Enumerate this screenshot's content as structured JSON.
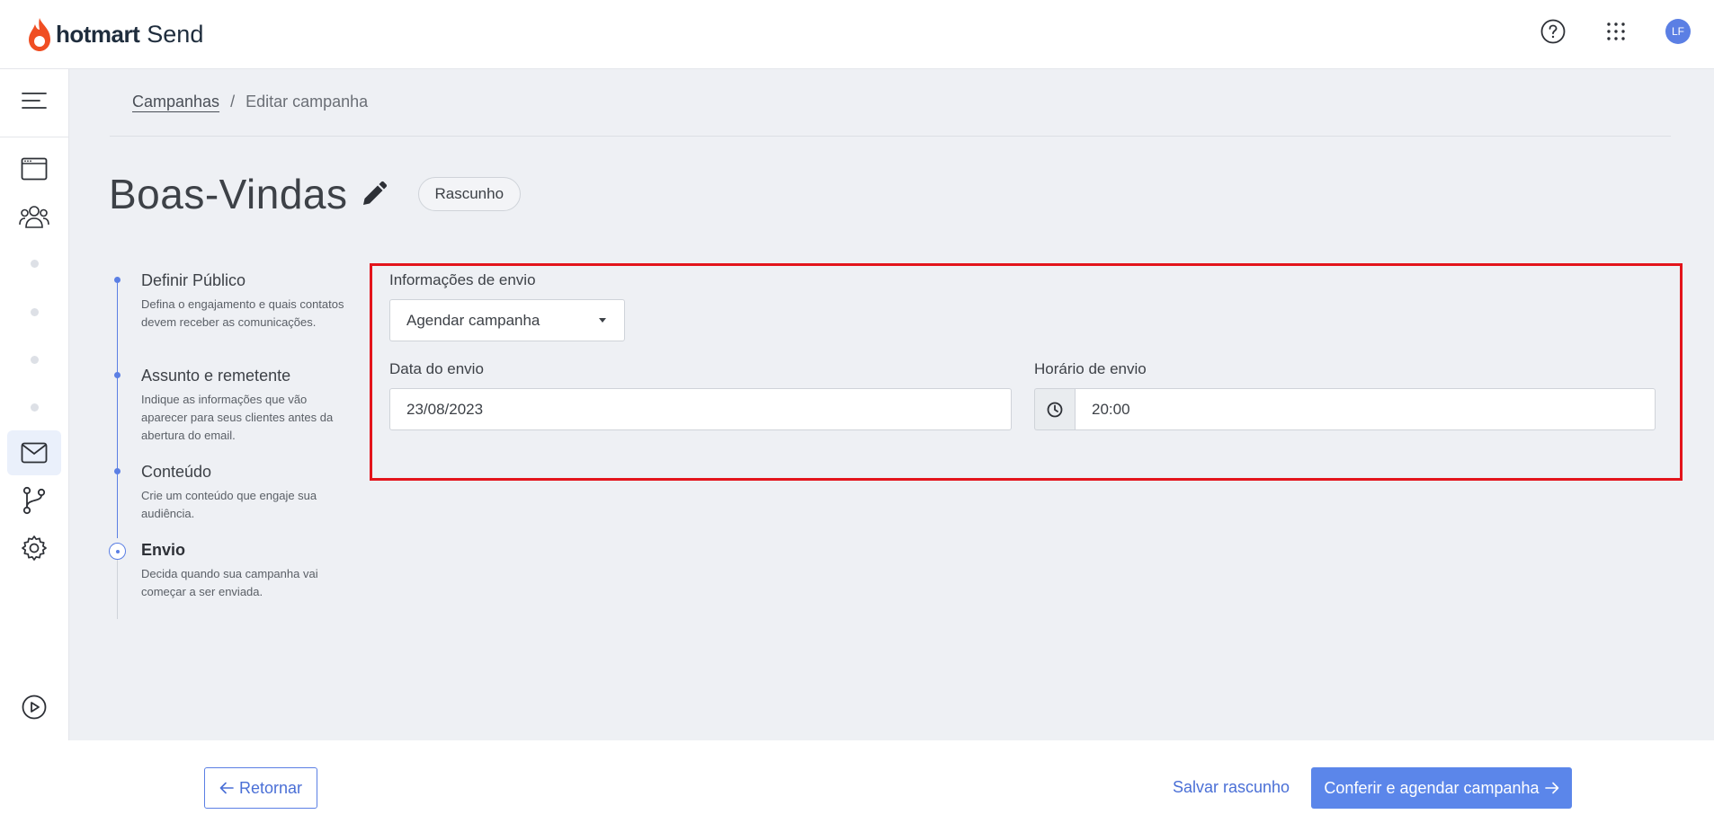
{
  "app": {
    "brand_hot": "hotmart",
    "brand_product": "Send",
    "avatar_initials": "LF"
  },
  "icons": {
    "help": "help-circle-icon",
    "apps": "apps-grid-icon",
    "menu": "menu-icon",
    "edit": "pencil-icon",
    "clock": "clock-icon"
  },
  "colors": {
    "accent": "#5b86ea",
    "brand_flame": "#f04e23",
    "highlight_border": "#e3141b"
  },
  "breadcrumb": {
    "root": "Campanhas",
    "separator": "/",
    "current": "Editar campanha"
  },
  "campaign": {
    "title": "Boas-Vindas",
    "status": "Rascunho"
  },
  "steps": [
    {
      "title": "Definir Público",
      "desc": "Defina o engajamento e quais contatos devem receber as comunicações."
    },
    {
      "title": "Assunto e remetente",
      "desc": "Indique as informações que vão aparecer para seus clientes antes da abertura do email."
    },
    {
      "title": "Conteúdo",
      "desc": "Crie um conteúdo que engaje sua audiência."
    },
    {
      "title": "Envio",
      "desc": "Decida quando sua campanha vai começar a ser enviada."
    }
  ],
  "form": {
    "section_label": "Informações de envio",
    "send_mode": "Agendar campanha",
    "date_label": "Data do envio",
    "date_value": "23/08/2023",
    "time_label": "Horário de envio",
    "time_value": "20:00"
  },
  "footer": {
    "back_label": "Retornar",
    "save_draft_label": "Salvar rascunho",
    "confirm_label": "Conferir e agendar campanha"
  }
}
